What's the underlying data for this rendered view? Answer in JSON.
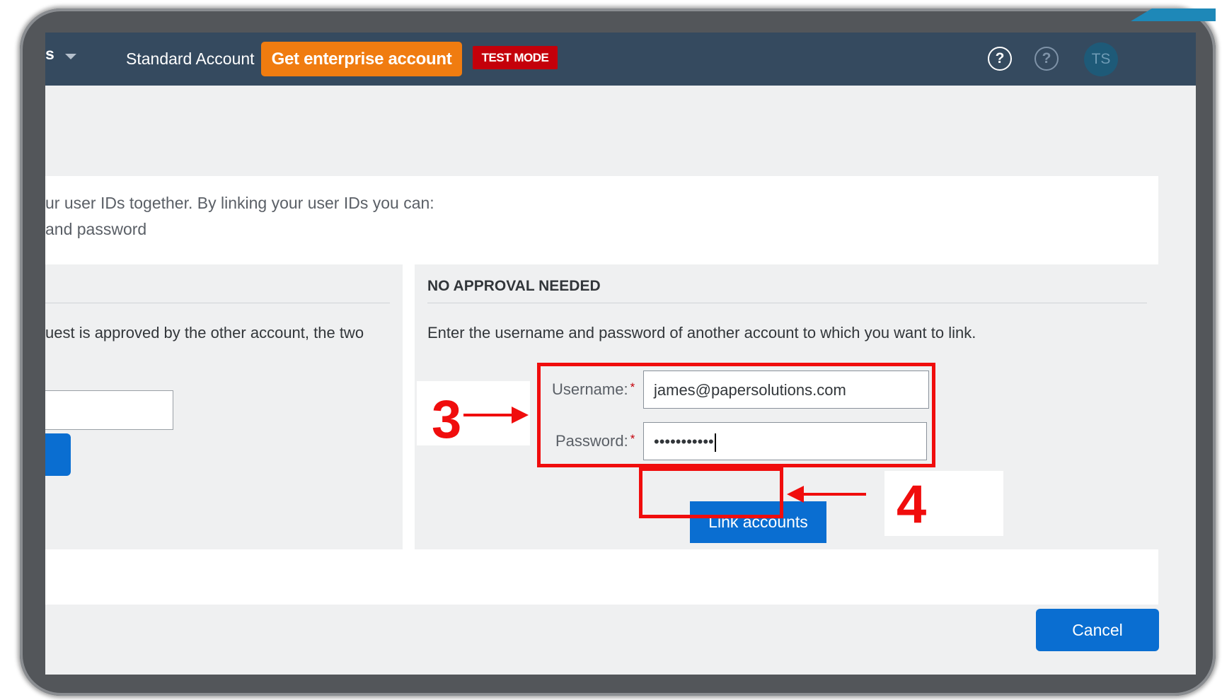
{
  "topbar": {
    "product_label": "s",
    "account_type": "Standard Account",
    "enterprise_button": "Get enterprise account",
    "mode_badge": "TEST MODE",
    "help_icon": "?",
    "help_icon_secondary": "?",
    "avatar_initials": "TS"
  },
  "intro": {
    "line1": "ur user IDs together. By linking your user IDs you can:",
    "line2": "and password"
  },
  "left_panel": {
    "description": "uest is approved by the other account, the two"
  },
  "right_panel": {
    "title": "NO APPROVAL NEEDED",
    "description": "Enter the username and password of another account to which you want to link.",
    "username_label": "Username:",
    "username_value": "james@papersolutions.com",
    "password_label": "Password:",
    "password_value": "•••••••••••",
    "required_mark": "*",
    "link_button": "Link accounts"
  },
  "annotations": {
    "step3": "3",
    "step4": "4"
  },
  "footer": {
    "cancel_button": "Cancel"
  },
  "colors": {
    "topbar": "#354a5f",
    "enterprise": "#f07c10",
    "test_mode": "#c4000a",
    "primary_button": "#0a6ed1",
    "annotation_red": "#f00d0d"
  }
}
